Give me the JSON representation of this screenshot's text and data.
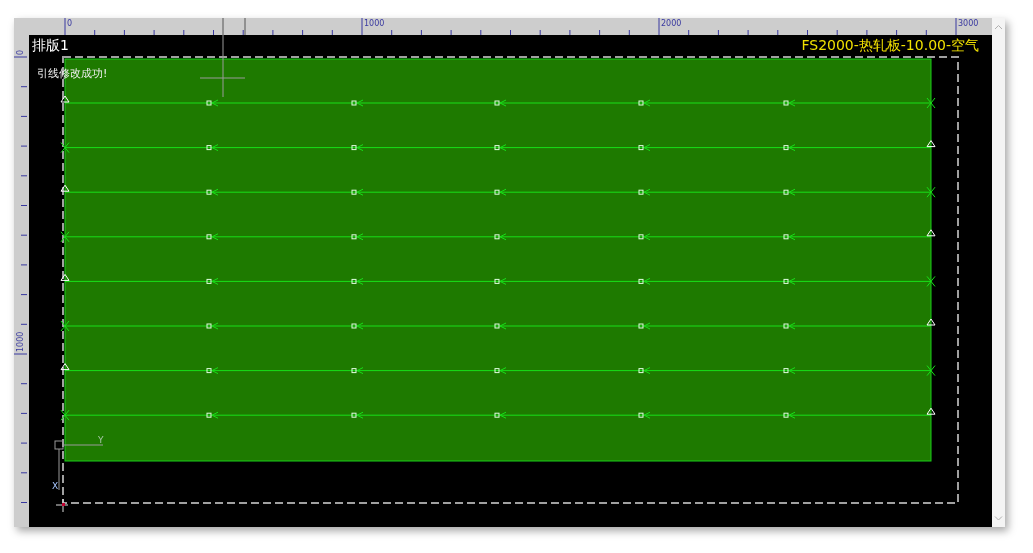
{
  "ruler": {
    "top_labels": [
      "0",
      "1000",
      "2000",
      "3000"
    ],
    "left_labels": [
      "0",
      "1000"
    ]
  },
  "canvas": {
    "title": "排版1",
    "material": "FS2000-热轧板-10.00-空气",
    "message": "引线修改成功!",
    "axis": {
      "y_label": "Y",
      "x_label": "X"
    },
    "rows": [
      {
        "kind": "left"
      },
      {
        "kind": "right"
      },
      {
        "kind": "left"
      },
      {
        "kind": "right"
      },
      {
        "kind": "left"
      },
      {
        "kind": "right"
      },
      {
        "kind": "left"
      },
      {
        "kind": "right"
      }
    ]
  }
}
